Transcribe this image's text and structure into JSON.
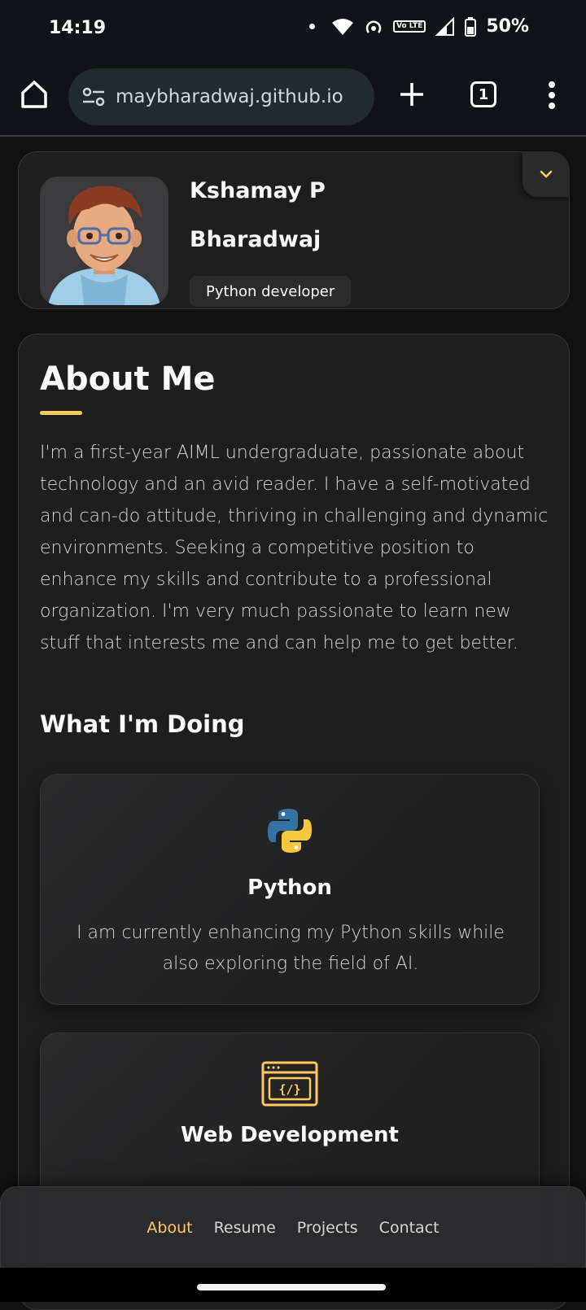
{
  "status_bar": {
    "time": "14:19",
    "network_badge": "Vo LTE",
    "battery": "50%"
  },
  "browser": {
    "url": "maybharadwaj.github.io",
    "tab_count": "1"
  },
  "sidebar": {
    "name_line1": "Kshamay P",
    "name_line2": "Bharadwaj",
    "title": "Python developer"
  },
  "about": {
    "heading": "About Me",
    "text": "I'm a first-year AIML undergraduate, passionate about technology and an avid reader. I have a self-motivated and can-do attitude, thriving in challenging and dynamic environments. Seeking a competitive position to enhance my skills and contribute to a professional organization. I'm very much passionate to learn new stuff that interests me and can help me to get better.",
    "services_heading": "What I'm Doing",
    "services": [
      {
        "title": "Python",
        "text": "I am currently enhancing my Python skills while also exploring the field of AI.",
        "icon": "python-logo-icon"
      },
      {
        "title": "Web Development",
        "text": "",
        "icon": "code-window-icon"
      }
    ]
  },
  "nav": {
    "items": [
      "About",
      "Resume",
      "Projects",
      "Contact"
    ],
    "active": "About"
  },
  "colors": {
    "accent": "#ffc960",
    "card_bg": "#1e1e1f",
    "page_bg": "#121212"
  }
}
